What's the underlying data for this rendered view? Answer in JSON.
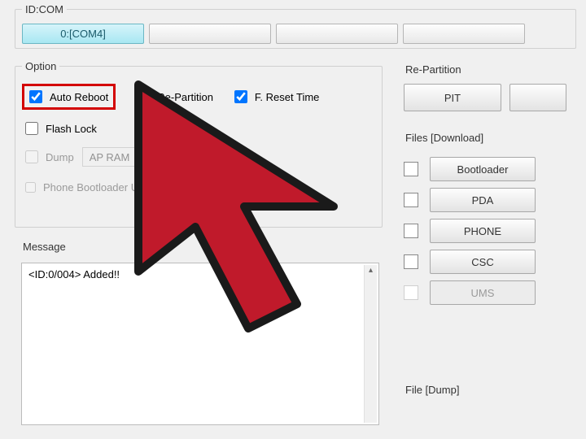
{
  "idcom": {
    "legend": "ID:COM",
    "active_slot": "0:[COM4]"
  },
  "option": {
    "legend": "Option",
    "auto_reboot": {
      "label": "Auto Reboot",
      "checked": true
    },
    "re_partition": {
      "label": "Re-Partition",
      "checked": false
    },
    "f_reset_time": {
      "label": "F. Reset Time",
      "checked": true
    },
    "flash_lock": {
      "label": "Flash Lock",
      "checked": false
    },
    "dump": {
      "label": "Dump",
      "selected": "AP RAM"
    },
    "phone_bl_update": {
      "label": "Phone Bootloader Update"
    }
  },
  "repartition": {
    "legend": "Re-Partition",
    "pit_btn": "PIT"
  },
  "files": {
    "legend": "Files [Download]",
    "rows": [
      {
        "label": "Bootloader",
        "enabled": true
      },
      {
        "label": "PDA",
        "enabled": true
      },
      {
        "label": "PHONE",
        "enabled": true
      },
      {
        "label": "CSC",
        "enabled": true
      },
      {
        "label": "UMS",
        "enabled": false
      }
    ]
  },
  "message": {
    "legend": "Message",
    "text": "<ID:0/004> Added!!"
  },
  "filedump": {
    "legend": "File [Dump]"
  },
  "cursor_color": "#c01a2b"
}
